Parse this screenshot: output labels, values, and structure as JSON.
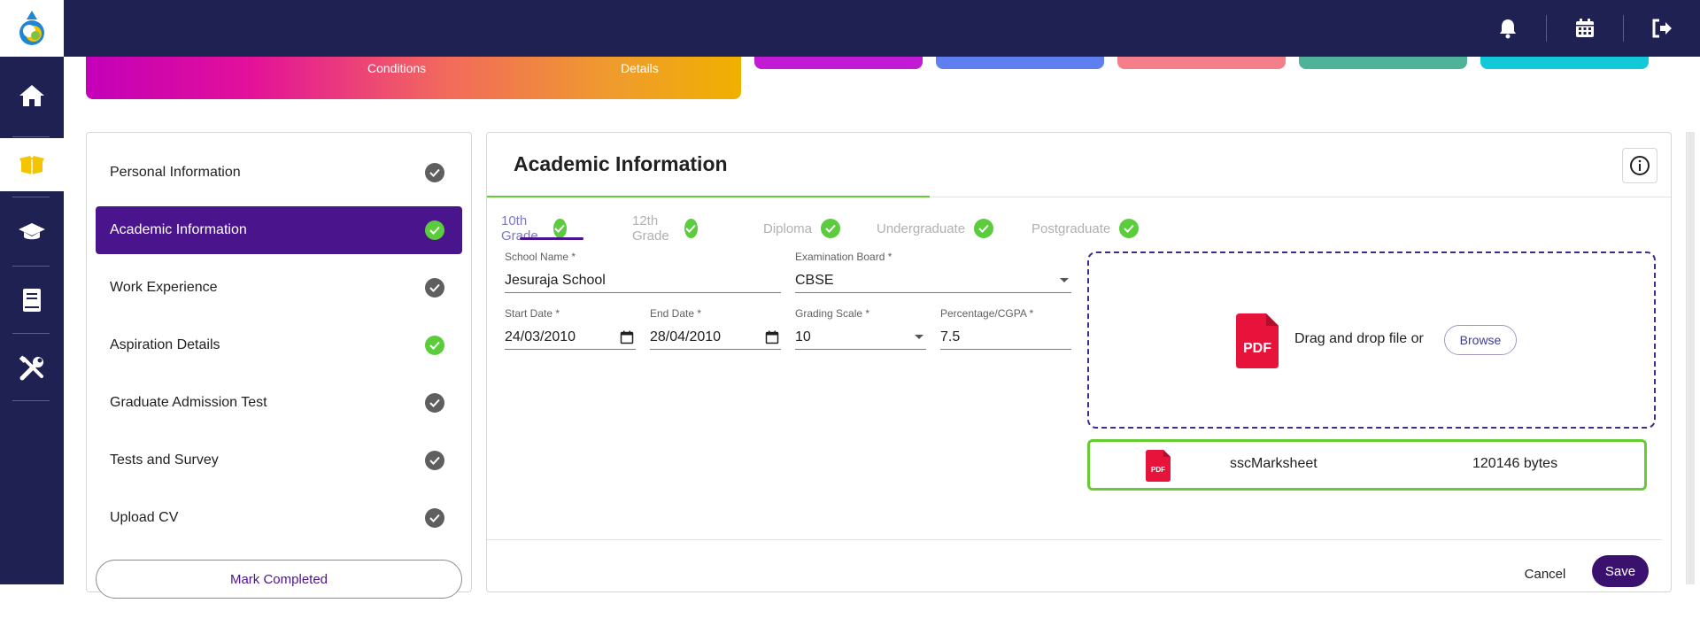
{
  "banner": {
    "text_1": "Conditions",
    "text_2": "Details"
  },
  "chips": [
    "#c21bd6",
    "#5f7ff0",
    "#f47f8a",
    "#4fb39a",
    "#13c9d9"
  ],
  "steps": [
    {
      "label": "Personal Information",
      "done": false
    },
    {
      "label": "Academic Information",
      "done": true
    },
    {
      "label": "Work Experience",
      "done": false
    },
    {
      "label": "Aspiration Details",
      "done": true
    },
    {
      "label": "Graduate Admission Test",
      "done": false
    },
    {
      "label": "Tests and Survey",
      "done": false
    },
    {
      "label": "Upload CV",
      "done": false
    }
  ],
  "mark_completed": "Mark Completed",
  "main": {
    "title": "Academic Information",
    "tabs": [
      "10th Grade",
      "12th Grade",
      "Diploma",
      "Undergraduate",
      "Postgraduate"
    ],
    "active_tab": "10th Grade",
    "fields": {
      "school_name": {
        "label": "School Name *",
        "value": "Jesuraja School"
      },
      "exam_board": {
        "label": "Examination Board *",
        "value": "CBSE"
      },
      "start_date": {
        "label": "Start Date *",
        "value": "24/03/2010"
      },
      "end_date": {
        "label": "End Date *",
        "value": "28/04/2010"
      },
      "grading_scale": {
        "label": "Grading Scale *",
        "value": "10"
      },
      "percentage": {
        "label": "Percentage/CGPA *",
        "value": "7.5"
      }
    },
    "upload": {
      "prompt": "Drag and drop file or",
      "browse": "Browse",
      "pdf_label": "PDF",
      "file_name": "sscMarksheet",
      "file_size": "120146 bytes"
    },
    "cancel": "Cancel",
    "save": "Save"
  },
  "colors": {
    "nav_bg": "#1e2152",
    "accent": "#4a148c",
    "success": "#66cc33",
    "pdf_red": "#e8133a"
  }
}
